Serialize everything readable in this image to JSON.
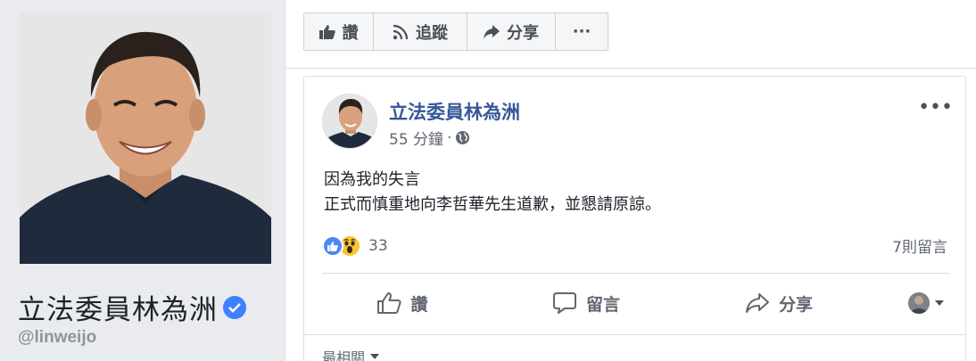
{
  "profile": {
    "name": "立法委員林為洲",
    "handle": "@linweijo",
    "verified_color": "#4080ff"
  },
  "page_actions": {
    "like_label": "讚",
    "follow_label": "追蹤",
    "share_label": "分享",
    "more_label": "···"
  },
  "post": {
    "author": "立法委員林為洲",
    "time": "55 分鐘",
    "audience_icon": "globe-icon",
    "options_label": "•••",
    "text_line1": "因為我的失言",
    "text_line2": "正式而慎重地向李哲華先生道歉，並懇請原諒。",
    "reaction_count": "33",
    "comment_count": "7則留言",
    "actions": {
      "like": "讚",
      "comment": "留言",
      "share": "分享"
    },
    "sort_label": "最相關"
  },
  "colors": {
    "link": "#365899",
    "like_blue": "#4a88f5",
    "wow_yellow": "#f7c532",
    "left_bg": "#e9ebee"
  }
}
